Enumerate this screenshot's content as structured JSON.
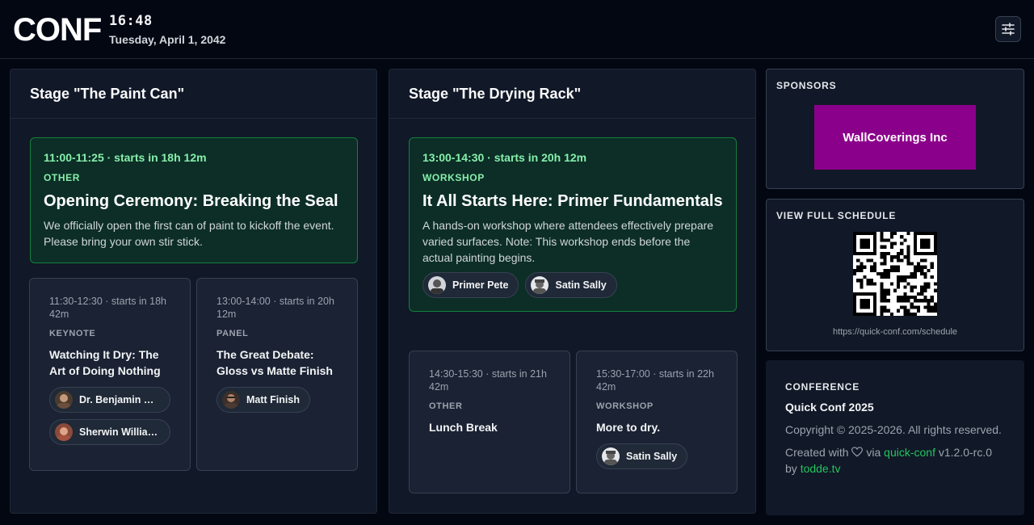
{
  "header": {
    "logo": "CONF",
    "time": "16:48",
    "date": "Tuesday, April 1, 2042"
  },
  "stages": [
    {
      "name": "Stage \"The Paint Can\"",
      "featured": {
        "time": "11:00-11:25 · starts in 18h 12m",
        "category": "OTHER",
        "title": "Opening Ceremony: Breaking the Seal",
        "description": "We officially open the first can of paint to kickoff the event. Please bring your own stir stick.",
        "speakers": []
      },
      "upcoming": [
        {
          "time": "11:30-12:30 · starts in 18h 42m",
          "category": "KEYNOTE",
          "title": "Watching It Dry: The Art of Doing Nothing",
          "speakers": [
            "Dr. Benjamin Moore",
            "Sherwin Williams"
          ]
        },
        {
          "time": "13:00-14:00 · starts in 20h 12m",
          "category": "PANEL",
          "title": "The Great Debate: Gloss vs Matte Finish",
          "speakers": [
            "Matt Finish"
          ]
        }
      ]
    },
    {
      "name": "Stage \"The Drying Rack\"",
      "featured": {
        "time": "13:00-14:30 · starts in 20h 12m",
        "category": "WORKSHOP",
        "title": "It All Starts Here: Primer Fundamentals",
        "description": "A hands-on workshop where attendees effectively prepare varied surfaces. Note: This workshop ends before the actual painting begins.",
        "speakers": [
          "Primer Pete",
          "Satin Sally"
        ]
      },
      "upcoming": [
        {
          "time": "14:30-15:30 · starts in 21h 42m",
          "category": "OTHER",
          "title": "Lunch Break",
          "speakers": []
        },
        {
          "time": "15:30-17:00 · starts in 22h 42m",
          "category": "WORKSHOP",
          "title": "More to dry.",
          "speakers": [
            "Satin Sally"
          ]
        }
      ]
    }
  ],
  "sponsors": {
    "label": "SPONSORS",
    "name": "WallCoverings Inc",
    "color": "#8b008b"
  },
  "schedule": {
    "label": "VIEW FULL SCHEDULE",
    "url": "https://quick-conf.com/schedule"
  },
  "footer": {
    "label": "CONFERENCE",
    "name": "Quick Conf 2025",
    "copyright": "Copyright © 2025-2026. All rights reserved.",
    "created_prefix": "Created with",
    "via": "via",
    "project": "quick-conf",
    "version": "v1.2.0-rc.0",
    "by": "by",
    "author": "todde.tv"
  },
  "colors": {
    "background": "#030712",
    "panel": "#111827",
    "featured_bg": "#0c2e26",
    "accent_green": "#86efac",
    "link_green": "#22c55e"
  }
}
